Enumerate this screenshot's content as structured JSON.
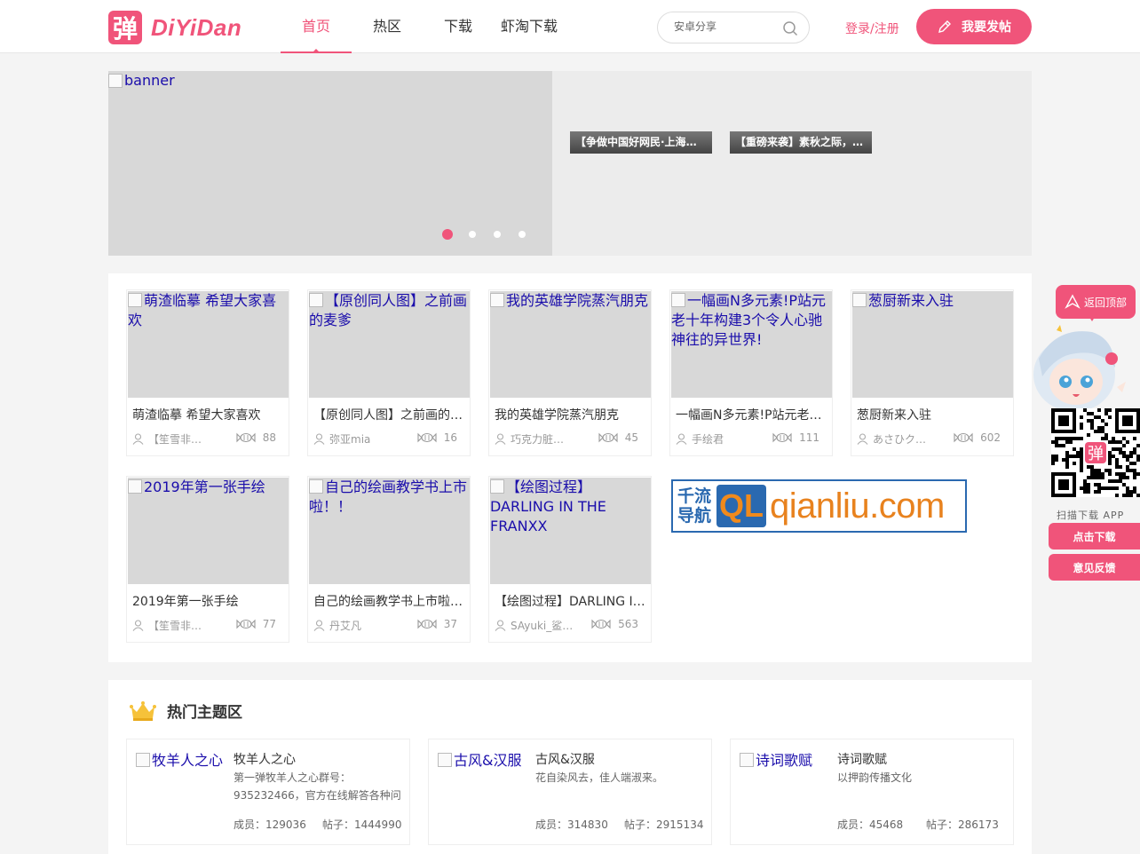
{
  "header": {
    "logo_char": "弹",
    "logo_text": "DiYiDan",
    "nav": [
      "首页",
      "热区",
      "下载",
      "虾淘下载"
    ],
    "search_placeholder": "安卓分享",
    "login": "登录/注册",
    "post_button": "我要发帖"
  },
  "banner": {
    "main_alt": "banner",
    "tags": [
      "【争做中国好网民·上海网…",
      "【重磅来袭】素秋之际，…"
    ],
    "dots_count": 4,
    "active_dot": 1
  },
  "works": [
    {
      "img_alt": "萌渣临摹 希望大家喜欢",
      "title": "萌渣临摹 希望大家喜欢",
      "author": "【笙雪非…",
      "count": "88"
    },
    {
      "img_alt": "【原创同人图】之前画的麦爹",
      "title": "【原创同人图】之前画的…",
      "author": "弥亚mia",
      "count": "16"
    },
    {
      "img_alt": "我的英雄学院蒸汽朋克",
      "title": "我的英雄学院蒸汽朋克",
      "author": "巧克力脏…",
      "count": "45"
    },
    {
      "img_alt": "一幅画N多元素!P站元老十年构建3个令人心驰神往的异世界!",
      "title": "一幅画N多元素!P站元老…",
      "author": "手绘君",
      "count": "111"
    },
    {
      "img_alt": "葱厨新来入驻",
      "title": "葱厨新来入驻",
      "author": "あさひク…",
      "count": "602"
    },
    {
      "img_alt": "2019年第一张手绘",
      "title": "2019年第一张手绘",
      "author": "【笙雪非…",
      "count": "77"
    },
    {
      "img_alt": "自己的绘画教学书上市啦！！",
      "title": "自己的绘画教学书上市啦…",
      "author": "丹艾凡",
      "count": "37"
    },
    {
      "img_alt": "【绘图过程】DARLING IN THE FRANXX",
      "title": "【绘图过程】DARLING I…",
      "author": "SAyuki_鲨…",
      "count": "563"
    }
  ],
  "ad": {
    "cn_line1": "千流",
    "cn_line2": "导航",
    "badge": "QL",
    "domain": "qianliu.com"
  },
  "topics": {
    "title": "热门主题区",
    "items": [
      {
        "img_alt": "牧羊人之心",
        "name": "牧羊人之心",
        "desc": "第一弹牧羊人之心群号：935232466，官方在线解答各种问",
        "members_label": "成员：",
        "members": "129036",
        "posts_label": "帖子：",
        "posts": "1444990"
      },
      {
        "img_alt": "古风&汉服",
        "name": "古风&汉服",
        "desc": "花自染风去，佳人端淑来。",
        "members_label": "成员：",
        "members": "314830",
        "posts_label": "帖子：",
        "posts": "2915134"
      },
      {
        "img_alt": "诗词歌赋",
        "name": "诗词歌赋",
        "desc": "以押韵传播文化",
        "members_label": "成员：",
        "members": "45468",
        "posts_label": "帖子：",
        "posts": "286173"
      }
    ]
  },
  "float": {
    "back_top": "返回顶部",
    "qr_label": "扫描下载 APP",
    "download": "点击下载",
    "feedback": "意见反馈"
  },
  "colors": {
    "accent": "#f0547a",
    "link": "#1a0dab"
  }
}
